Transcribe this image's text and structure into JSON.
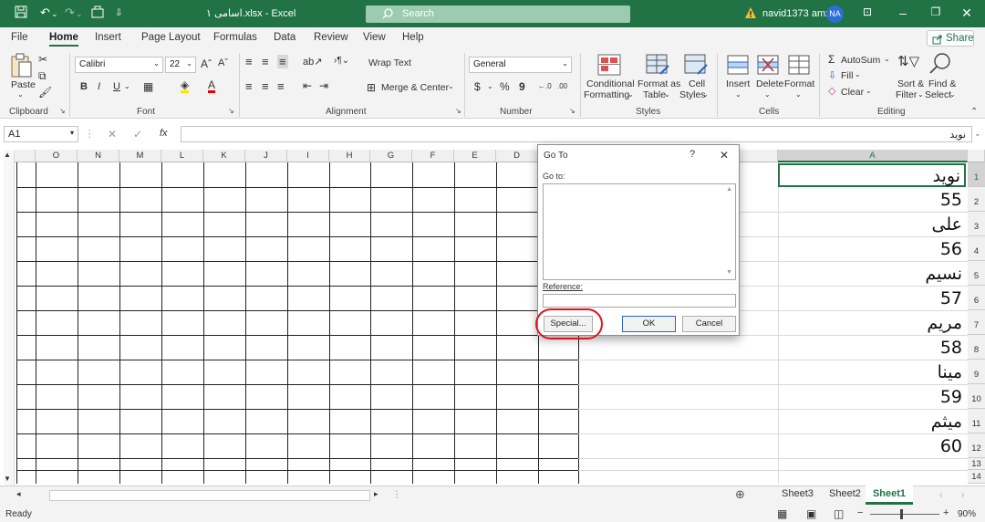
{
  "titlebar": {
    "qa_icons": [
      "save-icon",
      "undo-icon",
      "redo-icon",
      "touch-mode-icon",
      "customize-icon"
    ],
    "title": "اسامی ۱.xlsx  -  Excel",
    "search_placeholder": "Search",
    "user": "navid1373 amz",
    "initials": "NA",
    "bg": "#217346"
  },
  "menu": [
    "File",
    "Home",
    "Insert",
    "Page Layout",
    "Formulas",
    "Data",
    "Review",
    "View",
    "Help"
  ],
  "share": "Share",
  "ribbon": {
    "clipboard": {
      "label": "Clipboard",
      "paste": "Paste"
    },
    "font": {
      "label": "Font",
      "name": "Calibri",
      "size": "22",
      "grow": "Aˆ",
      "shrink": "Aˇ",
      "bold": "B",
      "italic": "I",
      "underline": "U",
      "font_color": "A"
    },
    "alignment": {
      "label": "Alignment",
      "wrap": "Wrap Text",
      "merge": "Merge & Center"
    },
    "number": {
      "label": "Number",
      "format": "General",
      "currency": "$",
      "percent": "%",
      "comma": "9",
      "inc": "←.0",
      "dec": ".00"
    },
    "styles": {
      "label": "Styles",
      "cond1": "Conditional",
      "cond2": "Formatting",
      "fmt1": "Format as",
      "fmt2": "Table",
      "cell1": "Cell",
      "cell2": "Styles"
    },
    "cells": {
      "label": "Cells",
      "insert": "Insert",
      "delete": "Delete",
      "format": "Format"
    },
    "editing": {
      "label": "Editing",
      "autosum": "AutoSum",
      "fill": "Fill",
      "clear": "Clear",
      "sort1": "Sort &",
      "sort2": "Filter",
      "find1": "Find &",
      "find2": "Select"
    }
  },
  "formula_bar": {
    "namebox": "A1",
    "fx": "fx",
    "value": "نوید"
  },
  "columns": [
    "O",
    "N",
    "M",
    "L",
    "K",
    "J",
    "I",
    "H",
    "G",
    "F",
    "E",
    "D",
    "A"
  ],
  "rows": [
    "1",
    "2",
    "3",
    "4",
    "5",
    "6",
    "7",
    "8",
    "9",
    "10",
    "11",
    "12",
    "13",
    "14"
  ],
  "cells_A": [
    "نوید",
    "55",
    "علی",
    "56",
    "نسیم",
    "57",
    "مریم",
    "58",
    "مینا",
    "59",
    "میثم",
    "60",
    "",
    ""
  ],
  "dialog": {
    "title": "Go To",
    "help": "?",
    "close": "✕",
    "goto_label": "Go to:",
    "reference_label": "Reference:",
    "special": "Special...",
    "ok": "OK",
    "cancel": "Cancel"
  },
  "sheets": [
    "Sheet3",
    "Sheet2",
    "Sheet1"
  ],
  "status": {
    "ready": "Ready",
    "zoom": "90%"
  }
}
